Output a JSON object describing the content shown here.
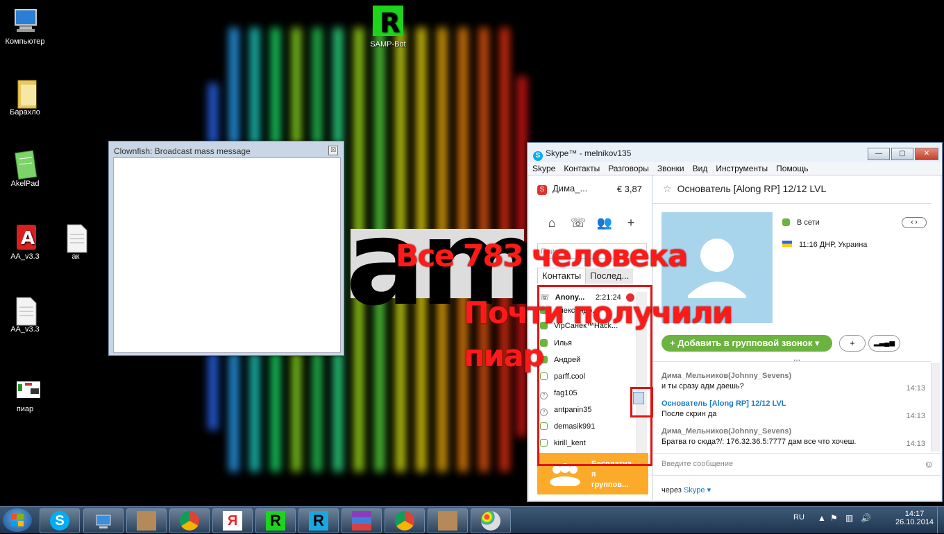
{
  "desktop": {
    "icons": [
      {
        "label": "Компьютер",
        "icon": "computer-icon"
      },
      {
        "label": "Барахло",
        "icon": "folder-icon"
      },
      {
        "label": "AkelPad",
        "icon": "notepad-icon"
      },
      {
        "label": "AA_v3.3",
        "icon": "app-a-icon"
      },
      {
        "label": "ак",
        "icon": "text-file-icon"
      },
      {
        "label": "AA_v3.3",
        "icon": "text-file-icon"
      },
      {
        "label": "пиар",
        "icon": "image-file-icon"
      },
      {
        "label": "SAMP-Bot",
        "icon": "samp-bot-icon",
        "glyph": "R"
      }
    ]
  },
  "clownfish": {
    "title": "Clownfish: Broadcast mass message",
    "close": "☒"
  },
  "skype": {
    "title": "Skype™ - melnikov135",
    "logo_glyph": "S",
    "window_buttons": [
      "—",
      "▢",
      "✕"
    ],
    "menu": [
      "Skype",
      "Контакты",
      "Разговоры",
      "Звонки",
      "Вид",
      "Инструменты",
      "Помощь"
    ],
    "account": {
      "name": "Дима_...",
      "credit": "€ 3,87"
    },
    "search_placeholder": "Поиск",
    "tabs": [
      "Контакты",
      "Послед..."
    ],
    "contacts": [
      {
        "name": "Anony...",
        "status": "call",
        "extra": "2:21:24"
      },
      {
        "name": "Александр...",
        "status": "on"
      },
      {
        "name": "VipСанёк™Hack...",
        "status": "on"
      },
      {
        "name": "Илья",
        "status": "on"
      },
      {
        "name": "Андрей",
        "status": "on"
      },
      {
        "name": "parff.cool",
        "status": "off"
      },
      {
        "name": "fag105",
        "status": "q"
      },
      {
        "name": "antpanin35",
        "status": "q"
      },
      {
        "name": "demasik991",
        "status": "off"
      },
      {
        "name": "kirill_kent",
        "status": "off"
      }
    ],
    "promo": {
      "line1": "Бесплатна",
      "line2": "я",
      "line3": "группов..."
    },
    "chat": {
      "title": "Основатель [Along RP] 12/12 LVL",
      "presence": "В сети",
      "location": "11:16 ДНР, Украина",
      "add_group_call": "Добавить в групповой звонок",
      "add_symbol": "+",
      "signal_symbol": "▂▃▄▅",
      "more": "...",
      "messages": [
        {
          "name": "Дима_Мельников(Johnny_Sevens)",
          "text": "и ты сразу адм даешь?",
          "time": "14:13",
          "self": true
        },
        {
          "name": "Основатель [Along RP] 12/12 LVL",
          "text": "После скрин да",
          "time": "14:13",
          "self": false
        },
        {
          "name": "Дима_Мельников(Johnny_Sevens)",
          "text": "Братва го сюда?/: 176.32.36.5:7777 дам все что хочеш.",
          "time": "14:13",
          "self": true
        }
      ],
      "input_placeholder": "Введите сообщение",
      "via_prefix": "через",
      "via_link": "Skype ▾"
    }
  },
  "overlay": {
    "line1": "Все 783 человека",
    "line2": "Почти получили",
    "line3": "пиар"
  },
  "taskbar": {
    "items": [
      "skype-icon",
      "network-icon",
      "avatar-app-icon",
      "chrome-icon",
      "yandex-icon",
      "samp-bot-icon",
      "samp-bot-icon",
      "winrar-icon",
      "chrome-icon",
      "avatar-app-icon",
      "paint-icon"
    ],
    "glyphs": {
      "yandex": "Я",
      "r": "R"
    },
    "lang": "RU",
    "time": "14:17",
    "date": "26.10.2014"
  }
}
